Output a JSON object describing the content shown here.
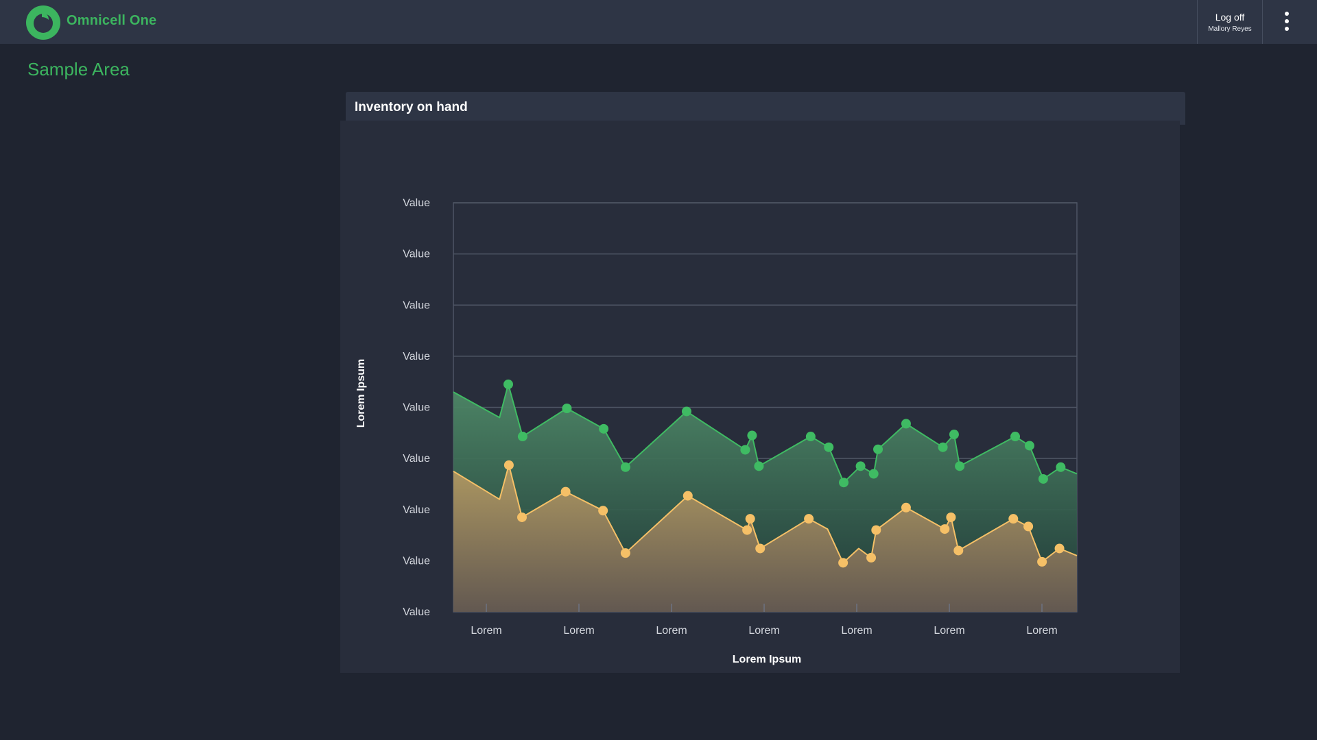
{
  "app": {
    "name": "Omnicell One"
  },
  "header": {
    "logoff_label": "Log off",
    "user_name": "Mallory Reyes"
  },
  "page": {
    "title": "Sample Area"
  },
  "card": {
    "title": "Inventory on hand"
  },
  "colors": {
    "brand_green": "#3cb55f",
    "series_green": "#3fbb63",
    "series_orange": "#f5c067"
  },
  "icons": {
    "logo": "omnicell-logo-icon",
    "menu": "vertical-dots-icon"
  },
  "chart_data": {
    "type": "area",
    "title": "",
    "xlabel": "Lorem Ipsum",
    "ylabel": "Lorem Ipsum",
    "y_tick_labels": [
      "Value",
      "Value",
      "Value",
      "Value",
      "Value",
      "Value",
      "Value",
      "Value",
      "Value"
    ],
    "x_tick_labels": [
      "Lorem",
      "Lorem",
      "Lorem",
      "Lorem",
      "Lorem",
      "Lorem",
      "Lorem"
    ],
    "x_range": [
      0,
      100
    ],
    "ylim": [
      0,
      8
    ],
    "grid": true,
    "legend": "none",
    "series": [
      {
        "color": "#3fbb63",
        "points": [
          {
            "x": 0,
            "y": 4.3,
            "marker": false
          },
          {
            "x": 7.4,
            "y": 3.8,
            "marker": false
          },
          {
            "x": 8.8,
            "y": 4.45,
            "marker": true
          },
          {
            "x": 11.1,
            "y": 3.43,
            "marker": true
          },
          {
            "x": 18.2,
            "y": 3.98,
            "marker": true
          },
          {
            "x": 24.1,
            "y": 3.58,
            "marker": true
          },
          {
            "x": 27.6,
            "y": 2.83,
            "marker": true
          },
          {
            "x": 37.4,
            "y": 3.92,
            "marker": true
          },
          {
            "x": 46.8,
            "y": 3.17,
            "marker": true
          },
          {
            "x": 47.9,
            "y": 3.45,
            "marker": true
          },
          {
            "x": 49.0,
            "y": 2.85,
            "marker": true
          },
          {
            "x": 57.3,
            "y": 3.43,
            "marker": true
          },
          {
            "x": 60.2,
            "y": 3.22,
            "marker": true
          },
          {
            "x": 62.6,
            "y": 2.53,
            "marker": true
          },
          {
            "x": 65.3,
            "y": 2.85,
            "marker": true
          },
          {
            "x": 67.4,
            "y": 2.7,
            "marker": true
          },
          {
            "x": 68.1,
            "y": 3.18,
            "marker": true
          },
          {
            "x": 72.6,
            "y": 3.68,
            "marker": true
          },
          {
            "x": 78.5,
            "y": 3.22,
            "marker": true
          },
          {
            "x": 80.3,
            "y": 3.47,
            "marker": true
          },
          {
            "x": 81.2,
            "y": 2.85,
            "marker": true
          },
          {
            "x": 90.1,
            "y": 3.43,
            "marker": true
          },
          {
            "x": 92.4,
            "y": 3.25,
            "marker": true
          },
          {
            "x": 94.6,
            "y": 2.6,
            "marker": true
          },
          {
            "x": 97.4,
            "y": 2.83,
            "marker": true
          },
          {
            "x": 100,
            "y": 2.7,
            "marker": false
          }
        ]
      },
      {
        "color": "#f5c067",
        "points": [
          {
            "x": 0,
            "y": 2.75,
            "marker": false
          },
          {
            "x": 7.4,
            "y": 2.2,
            "marker": false
          },
          {
            "x": 8.9,
            "y": 2.87,
            "marker": true
          },
          {
            "x": 11.0,
            "y": 1.85,
            "marker": true
          },
          {
            "x": 18.0,
            "y": 2.35,
            "marker": true
          },
          {
            "x": 24.0,
            "y": 1.98,
            "marker": true
          },
          {
            "x": 27.6,
            "y": 1.15,
            "marker": true
          },
          {
            "x": 37.6,
            "y": 2.27,
            "marker": true
          },
          {
            "x": 47.1,
            "y": 1.6,
            "marker": true
          },
          {
            "x": 47.6,
            "y": 1.82,
            "marker": true
          },
          {
            "x": 49.2,
            "y": 1.24,
            "marker": true
          },
          {
            "x": 57.0,
            "y": 1.82,
            "marker": true
          },
          {
            "x": 60.0,
            "y": 1.62,
            "marker": false
          },
          {
            "x": 62.5,
            "y": 0.96,
            "marker": true
          },
          {
            "x": 65.0,
            "y": 1.24,
            "marker": false
          },
          {
            "x": 67.0,
            "y": 1.06,
            "marker": true
          },
          {
            "x": 67.8,
            "y": 1.6,
            "marker": true
          },
          {
            "x": 72.6,
            "y": 2.04,
            "marker": true
          },
          {
            "x": 78.8,
            "y": 1.62,
            "marker": true
          },
          {
            "x": 79.8,
            "y": 1.85,
            "marker": true
          },
          {
            "x": 81.0,
            "y": 1.2,
            "marker": true
          },
          {
            "x": 89.8,
            "y": 1.82,
            "marker": true
          },
          {
            "x": 92.2,
            "y": 1.67,
            "marker": true
          },
          {
            "x": 94.4,
            "y": 0.98,
            "marker": true
          },
          {
            "x": 97.2,
            "y": 1.24,
            "marker": true
          },
          {
            "x": 100,
            "y": 1.1,
            "marker": false
          }
        ]
      }
    ]
  }
}
